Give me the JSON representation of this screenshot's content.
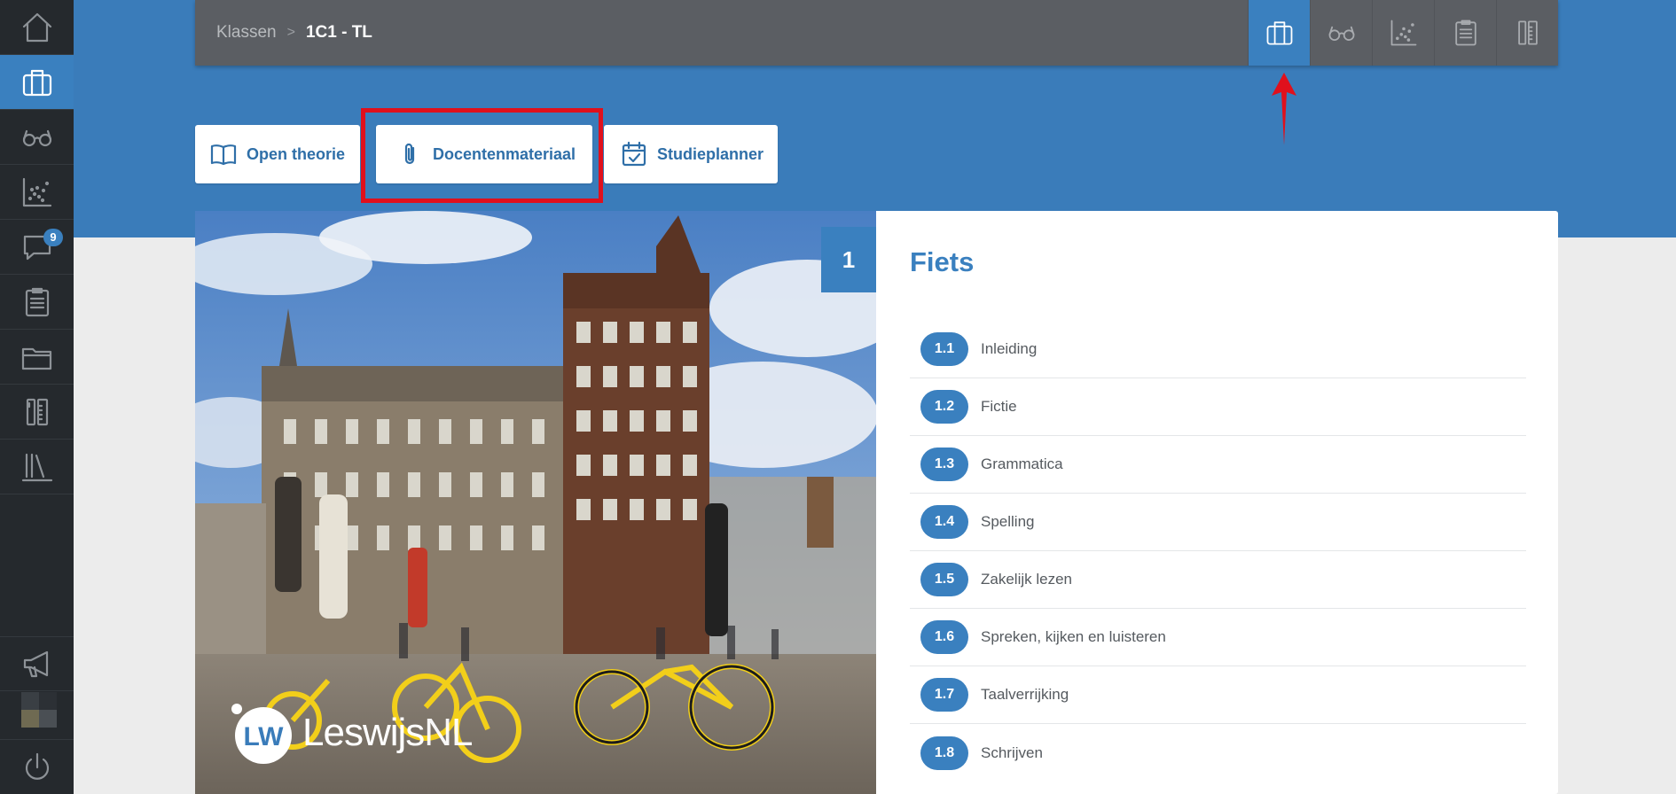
{
  "sidebar": {
    "items": [
      {
        "name": "home",
        "icon": "home-icon",
        "active": false
      },
      {
        "name": "classes",
        "icon": "briefcase-icon",
        "active": true
      },
      {
        "name": "review",
        "icon": "glasses-icon",
        "active": false
      },
      {
        "name": "results",
        "icon": "scatter-chart-icon",
        "active": false
      },
      {
        "name": "messages",
        "icon": "chat-bubble-icon",
        "active": false,
        "badge": "9"
      },
      {
        "name": "tasks",
        "icon": "clipboard-icon",
        "active": false
      },
      {
        "name": "files",
        "icon": "folder-icon",
        "active": false
      },
      {
        "name": "tools",
        "icon": "tools-icon",
        "active": false
      },
      {
        "name": "library",
        "icon": "library-icon",
        "active": false
      },
      {
        "name": "announcements",
        "icon": "megaphone-icon",
        "active": false
      },
      {
        "name": "logout",
        "icon": "power-icon",
        "active": false
      }
    ]
  },
  "topbar": {
    "breadcrumb": {
      "root": "Klassen",
      "separator": ">",
      "current": "1C1 - TL"
    },
    "nav": [
      {
        "icon": "briefcase-icon",
        "active": true
      },
      {
        "icon": "glasses-icon",
        "active": false
      },
      {
        "icon": "scatter-chart-icon",
        "active": false
      },
      {
        "icon": "clipboard-icon",
        "active": false
      },
      {
        "icon": "tools-icon",
        "active": false
      }
    ]
  },
  "actions": {
    "theory_label": "Open theorie",
    "teacher_material_label": "Docentenmateriaal",
    "study_planner_label": "Studieplanner"
  },
  "chapter": {
    "number": "1",
    "title": "Fiets",
    "lessons": [
      {
        "number": "1.1",
        "title": "Inleiding"
      },
      {
        "number": "1.2",
        "title": "Fictie"
      },
      {
        "number": "1.3",
        "title": "Grammatica"
      },
      {
        "number": "1.4",
        "title": "Spelling"
      },
      {
        "number": "1.5",
        "title": "Zakelijk lezen"
      },
      {
        "number": "1.6",
        "title": "Spreken, kijken en luisteren"
      },
      {
        "number": "1.7",
        "title": "Taalverrijking"
      },
      {
        "number": "1.8",
        "title": "Schrijven"
      }
    ]
  },
  "logo": {
    "mark": "LW",
    "text": "Leswijs",
    "suffix": "NL"
  },
  "colors": {
    "accent": "#3a80bf",
    "sidebar": "#25292d",
    "topbar": "#5b5e63",
    "highlight": "#e0101c"
  }
}
